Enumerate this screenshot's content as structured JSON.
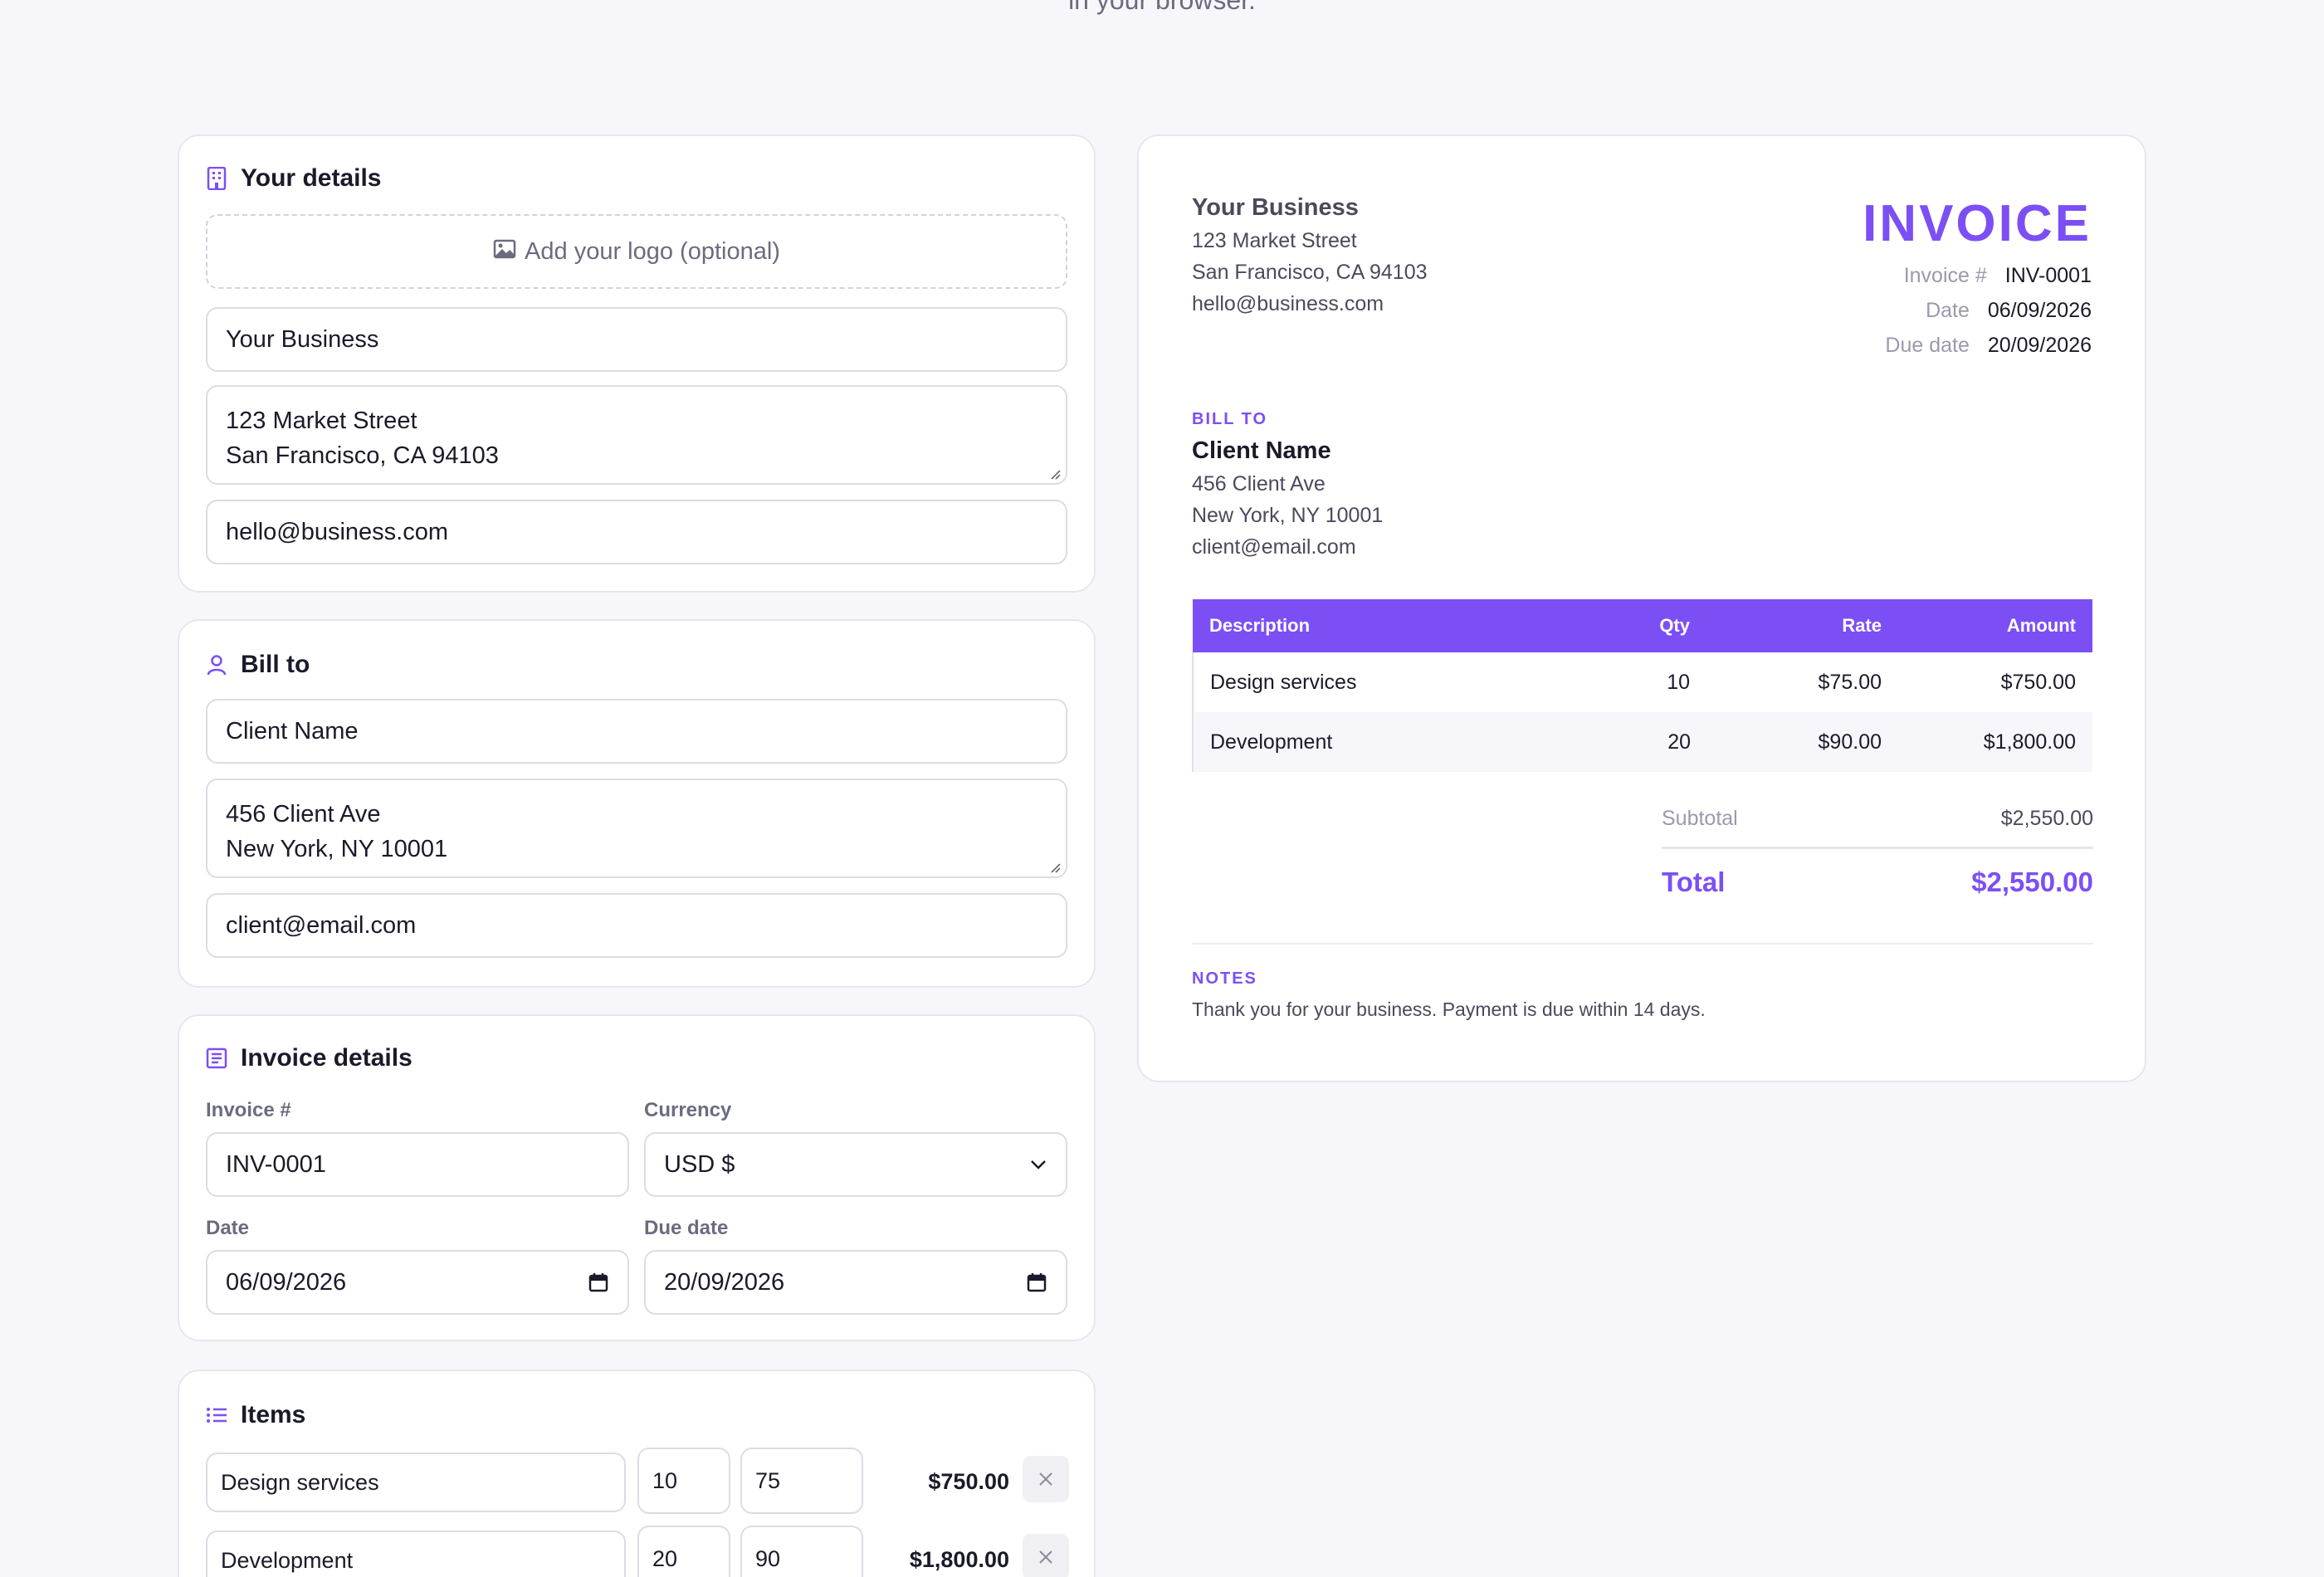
{
  "page": {
    "tagline": "in your browser."
  },
  "your_details": {
    "title": "Your details",
    "logo_label": "Add your logo (optional)",
    "business_name": "Your Business",
    "address_line1": "123 Market Street",
    "address_line2": "San Francisco, CA 94103",
    "email": "hello@business.com"
  },
  "bill_to": {
    "title": "Bill to",
    "client_name": "Client Name",
    "address_line1": "456 Client Ave",
    "address_line2": "New York, NY 10001",
    "email": "client@email.com"
  },
  "invoice_details": {
    "title": "Invoice details",
    "invoice_label": "Invoice #",
    "invoice_value": "INV-0001",
    "currency_label": "Currency",
    "currency_value": "USD $",
    "date_label": "Date",
    "date_value": "06/09/2026",
    "due_label": "Due date",
    "due_value": "20/09/2026"
  },
  "items_section": {
    "title": "Items",
    "rows": [
      {
        "description": "Design services",
        "qty": "10",
        "rate": "75",
        "amount": "$750.00"
      },
      {
        "description": "Development",
        "qty": "20",
        "rate": "90",
        "amount": "$1,800.00"
      }
    ]
  },
  "preview": {
    "business_name": "Your Business",
    "address_line1": "123 Market Street",
    "address_line2": "San Francisco, CA 94103",
    "email": "hello@business.com",
    "heading": "INVOICE",
    "meta": [
      {
        "key": "Invoice #",
        "value": "INV-0001"
      },
      {
        "key": "Date",
        "value": "06/09/2026"
      },
      {
        "key": "Due date",
        "value": "20/09/2026"
      }
    ],
    "bill_to_label": "BILL TO",
    "client_name": "Client Name",
    "client_line1": "456 Client Ave",
    "client_line2": "New York, NY 10001",
    "client_email": "client@email.com",
    "table": {
      "headers": [
        "Description",
        "Qty",
        "Rate",
        "Amount"
      ],
      "rows": [
        [
          "Design services",
          "10",
          "$75.00",
          "$750.00"
        ],
        [
          "Development",
          "20",
          "$90.00",
          "$1,800.00"
        ]
      ]
    },
    "subtotal_label": "Subtotal",
    "subtotal_value": "$2,550.00",
    "total_label": "Total",
    "total_value": "$2,550.00",
    "notes_label": "NOTES",
    "notes_text": "Thank you for your business. Payment is due within 14 days."
  },
  "colors": {
    "accent": "#7c4ff5",
    "background": "#f7f7fb",
    "border": "#e6e6ee"
  },
  "icons": [
    "building-icon",
    "image-icon",
    "user-icon",
    "receipt-icon",
    "list-icon",
    "chevron-down-icon",
    "calendar-icon",
    "close-icon"
  ]
}
